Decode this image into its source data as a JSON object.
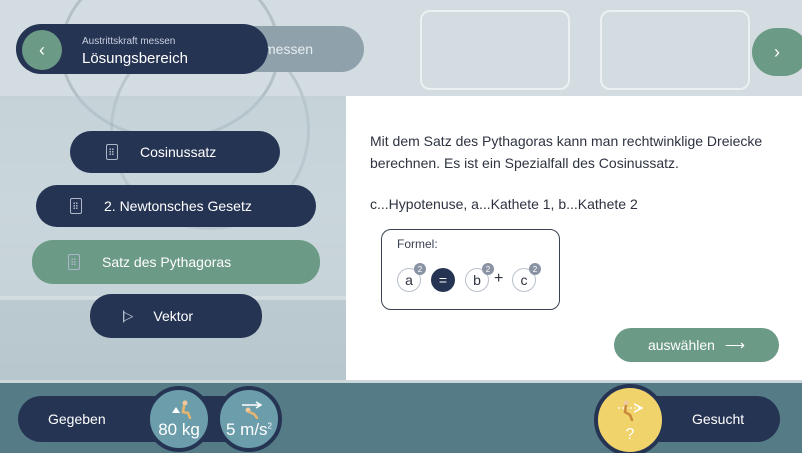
{
  "header": {
    "subtitle": "Austrittskraft messen",
    "title": "Lösungsbereich",
    "background_tab": "messen",
    "back_icon": "chevron-left-icon",
    "next_icon": "chevron-right-icon"
  },
  "menu": {
    "items": [
      {
        "label": "Cosinussatz",
        "icon": "calculator-icon",
        "active": false
      },
      {
        "label": "2. Newtonsches Gesetz",
        "icon": "calculator-icon",
        "active": false
      },
      {
        "label": "Satz des Pythagoras",
        "icon": "calculator-icon",
        "active": true
      },
      {
        "label": "Vektor",
        "icon": "vector-icon",
        "active": false
      }
    ]
  },
  "detail": {
    "description": "Mit dem Satz des Pythagoras kann man rechtwinklige Dreiecke berechnen. Es ist ein Spezialfall des Cosinussatz.",
    "legend": "c...Hypotenuse, a...Kathete 1, b...Kathete 2",
    "formula": {
      "label": "Formel:",
      "a": "a",
      "b": "b",
      "c": "c",
      "exponent": "2",
      "equals": "=",
      "plus": "+"
    },
    "select_label": "auswählen",
    "select_arrow": "⟶"
  },
  "bottom": {
    "given_label": "Gegeben",
    "given_values": [
      {
        "value": "80 kg",
        "icon": "person-weight-icon"
      },
      {
        "value": "5 m/s",
        "superscript": "2",
        "icon": "person-acceleration-icon"
      }
    ],
    "sought_label": "Gesucht",
    "sought_symbol": "?",
    "sought_icon": "person-force-icon"
  },
  "colors": {
    "navy": "#263454",
    "green": "#6b9a86",
    "teal": "#6b9dab",
    "yellow": "#f0d36a"
  }
}
